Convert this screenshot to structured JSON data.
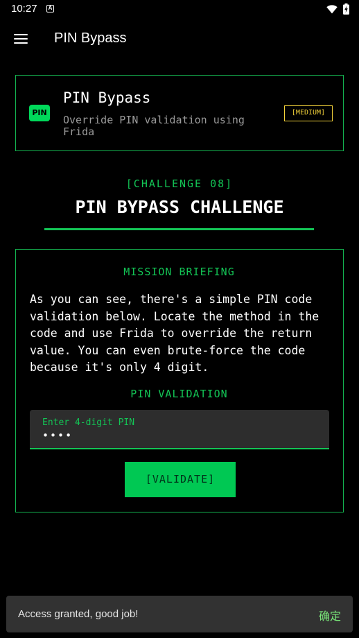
{
  "status_bar": {
    "time": "10:27",
    "notification_icon": "a-square-icon",
    "wifi_icon": "wifi-icon",
    "battery_icon": "battery-charging-icon"
  },
  "appbar": {
    "menu_icon": "hamburger-menu-icon",
    "title": "PIN Bypass"
  },
  "header_card": {
    "badge": "PIN",
    "title": "PIN Bypass",
    "subtitle": "Override PIN validation using Frida",
    "difficulty": "[MEDIUM]"
  },
  "challenge": {
    "tag": "[CHALLENGE 08]",
    "title": "PIN BYPASS CHALLENGE"
  },
  "mission": {
    "heading": "MISSION BRIEFING",
    "text": "As you can see, there's a simple PIN code validation below. Locate the method in the code and use Frida to override the return value. You can even brute-force the code because it's only 4 digit.",
    "pin_heading": "PIN VALIDATION",
    "pin_field_label": "Enter 4-digit PIN",
    "pin_field_value": "••••",
    "validate_label": "[VALIDATE]"
  },
  "snackbar": {
    "text": "Access granted, good job!",
    "action": "确定"
  },
  "colors": {
    "accent_green": "#13c455",
    "difficulty_yellow": "#f3d23a",
    "background": "#000000"
  }
}
